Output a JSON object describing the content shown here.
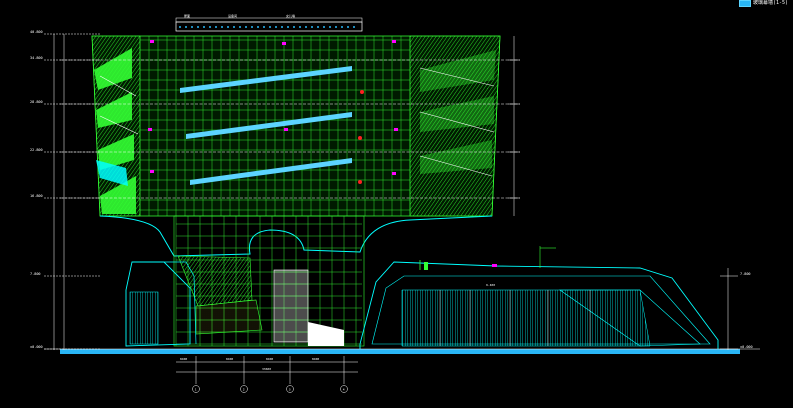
{
  "legend": {
    "label": "玻璃幕墙(1-5)",
    "color": "#29b6f6"
  },
  "colors": {
    "background": "#000000",
    "grid_green": "#33ff33",
    "glass_cyan": "#00ffff",
    "glass_blue": "#29b6f6",
    "dimension_white": "#ffffff",
    "accent_magenta": "#ff00ff",
    "accent_red": "#ff2020",
    "hatch_yellow": "#ffff00"
  },
  "levels": [
    {
      "label": "40.800"
    },
    {
      "label": "34.800"
    },
    {
      "label": "28.800"
    },
    {
      "label": "22.800"
    },
    {
      "label": "16.800"
    },
    {
      "label": "7.800"
    },
    {
      "label": "±0.000"
    }
  ],
  "right_levels": [
    {
      "label": "7.800"
    },
    {
      "label": "±0.000"
    }
  ],
  "axes": [
    {
      "label": "1"
    },
    {
      "label": "2"
    },
    {
      "label": "3"
    },
    {
      "label": "4"
    }
  ],
  "bottom_dims": [
    "8400",
    "8400",
    "8400",
    "8400"
  ],
  "bottom_total": "33600",
  "roof_tags": [
    "屋面",
    "设备间",
    "女儿墙"
  ],
  "podium_tag": "9.400",
  "floor_dims": [
    "5400",
    "6000",
    "6000",
    "6000"
  ]
}
